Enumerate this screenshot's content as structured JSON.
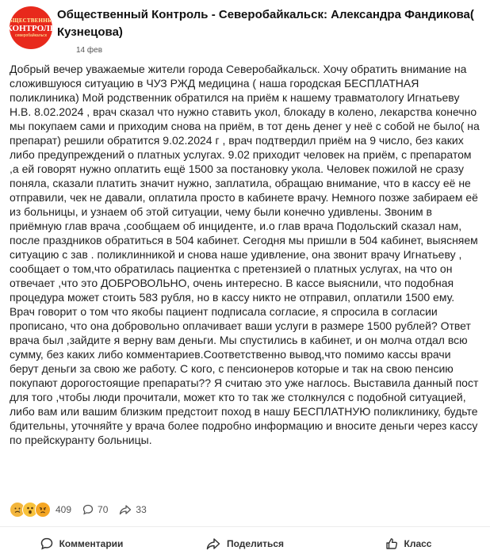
{
  "post": {
    "author": "Общественный Контроль - Северобайкальск: Александра Фандикова( Кузнецова)",
    "date": "14 фев",
    "avatar": {
      "line1": "ОБЩЕСТВЕННЫЙ",
      "line2": "КОНТРОЛЬ",
      "line3": "северобайкальск"
    },
    "text": "Добрый вечер уважаемые жители города Северобайкальск. Хочу обратить внимание на сложившуюся ситуацию в ЧУЗ РЖД медицина ( наша городская БЕСПЛАТНАЯ поликлиника) Мой родственник обратился на приём к нашему травматологу Игнатьеву Н.В. 8.02.2024 , врач сказал что нужно ставить укол, блокаду в колено, лекарства конечно мы покупаем сами и приходим снова на приём, в тот день денег у неё с собой не было( на препарат) решили обратится 9.02.2024 г , врач подтвердил приём на 9 число, без каких либо предупреждений о платных услугах. 9.02 приходит человек на приём, с препаратом ,а ей говорят нужно оплатить ещё 1500 за постановку укола. Человек пожилой не сразу поняла, сказали платить значит нужно, заплатила, обращаю внимание, что в кассу её не отправили, чек не давали, оплатила просто в кабинете врачу. Немного позже забираем её из больницы, и узнаем об этой ситуации, чему были конечно удивлены. Звоним в приёмную глав врача ,сообщаем об инциденте, и.о глав врача Подольский сказал нам, после праздников обратиться в 504 кабинет. Сегодня мы пришли в 504 кабинет, выясняем ситуацию с зав . поликлинникой и снова наше удивление, она звонит врачу Игнатьеву , сообщает о том,что обратилась пациентка с претензией о платных услугах, на что он отвечает ,что это ДОБРОВОЛЬНО, очень интересно. В кассе выяснили, что подобная процедура может стоить 583 рубля, но в кассу никто не отправил, оплатили 1500 ему. Врач говорит о том что якобы пациент подписала согласие, я спросила в согласии прописано, что она добровольно оплачивает ваши услуги в размере 1500 рублей? Ответ врача был ,зайдите я верну вам деньги. Мы спустились в кабинет, и он молча отдал всю сумму, без каких либо комментариев.Соответственно вывод,что помимо кассы врачи берут деньги за свою же работу. С кого, с пенсионеров которые и так на свою пенсию покупают дорогостоящие препараты?? Я считаю это уже наглось. Выставила данный пост для того ,чтобы люди прочитали, может кто то так же столкнулся с подобной ситуацией, либо вам или вашим близким предстоит поход в нашу БЕСПЛАТНУЮ поликлинику, будьте бдительны, уточняйте у врача более подробно информацию и вносите деньги через кассу по прейскуранту больницы."
  },
  "stats": {
    "reactions_count": "409",
    "comments_count": "70",
    "shares_count": "33",
    "reaction_icons": [
      "sad-face-icon",
      "surprised-face-icon",
      "sad-face-icon"
    ]
  },
  "actions": {
    "comments_label": "Комментарии",
    "share_label": "Поделиться",
    "like_label": "Класс"
  },
  "colors": {
    "avatar_bg": "#e8291c",
    "text": "#1f1f1f",
    "muted": "#555555"
  }
}
